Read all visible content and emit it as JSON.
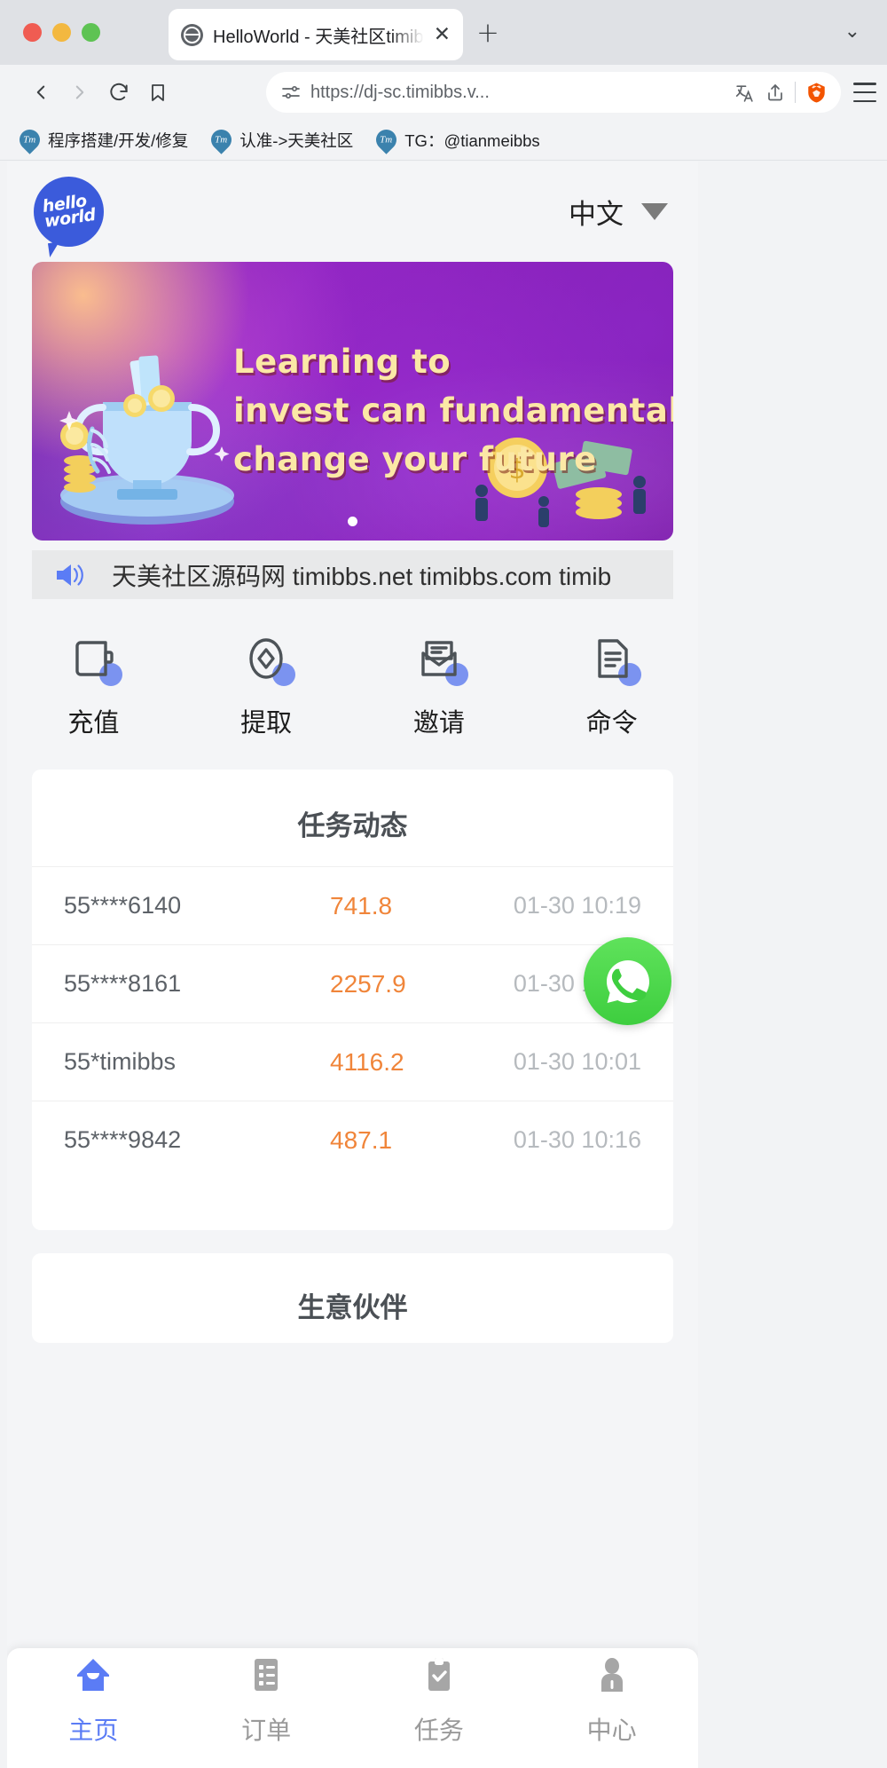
{
  "browser": {
    "tab": {
      "title": "HelloWorld - 天美社区timibbs.n",
      "close_label": "✕"
    },
    "new_tab_label": "+",
    "tab_list_caret": "⌄",
    "url": "https://dj-sc.timibbs.v...",
    "bookmarks": [
      {
        "icon": "timibbs-icon",
        "label": "程序搭建/开发/修复"
      },
      {
        "icon": "timibbs-icon",
        "label": "认准->天美社区"
      },
      {
        "icon": "timibbs-icon",
        "label": "TG：@tianmeibbs"
      }
    ]
  },
  "page": {
    "logo": {
      "line1": "hello",
      "line2": "world"
    },
    "language": {
      "value": "中文",
      "caret": "▼"
    },
    "banner": {
      "lines": [
        "Learning to",
        "invest can fundamentally",
        "change your future"
      ],
      "dots": 1,
      "active_dot": 0
    },
    "marquee": {
      "icon": "speaker-icon",
      "text": "天美社区源码网 timibbs.net timibbs.com timib"
    },
    "quick_menu": [
      {
        "icon": "wallet-icon",
        "label": "充值"
      },
      {
        "icon": "diamond-icon",
        "label": "提取"
      },
      {
        "icon": "envelope-icon",
        "label": "邀请"
      },
      {
        "icon": "document-icon",
        "label": "命令"
      }
    ],
    "task_card": {
      "title": "任务动态",
      "rows": [
        {
          "user": "55****6140",
          "amount": "741.8",
          "time": "01-30 10:19"
        },
        {
          "user": "55****8161",
          "amount": "2257.9",
          "time": "01-30 10:18"
        },
        {
          "user": "55*timibbs",
          "amount": "4116.2",
          "time": "01-30 10:01"
        },
        {
          "user": "55****9842",
          "amount": "487.1",
          "time": "01-30 10:16"
        }
      ]
    },
    "partner_card": {
      "title": "生意伙伴"
    },
    "floating_action": {
      "icon": "whatsapp-icon"
    },
    "tabbar": [
      {
        "icon": "home-icon",
        "label": "主页",
        "active": true
      },
      {
        "icon": "orders-icon",
        "label": "订单",
        "active": false
      },
      {
        "icon": "tasks-icon",
        "label": "任务",
        "active": false
      },
      {
        "icon": "user-icon",
        "label": "中心",
        "active": false
      }
    ]
  },
  "colors": {
    "accent_blue": "#5b7cf5",
    "amount_orange": "#f0853a",
    "banner_purple": "#8a1fb5",
    "whatsapp_green": "#3ece3f"
  }
}
